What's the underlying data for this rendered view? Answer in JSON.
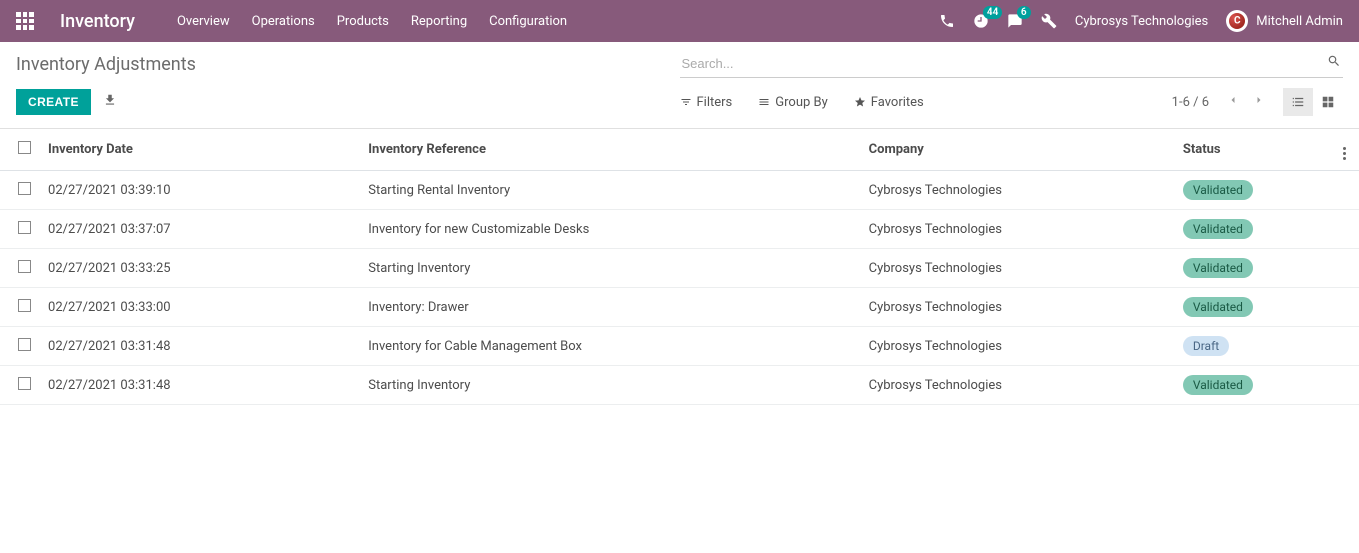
{
  "navbar": {
    "brand": "Inventory",
    "menu": [
      "Overview",
      "Operations",
      "Products",
      "Reporting",
      "Configuration"
    ],
    "activities_badge": "44",
    "messages_badge": "6",
    "company": "Cybrosys Technologies",
    "user": "Mitchell Admin"
  },
  "breadcrumb": "Inventory Adjustments",
  "search": {
    "placeholder": "Search..."
  },
  "buttons": {
    "create": "CREATE"
  },
  "filters": {
    "filters": "Filters",
    "groupby": "Group By",
    "favorites": "Favorites"
  },
  "pager": "1-6 / 6",
  "columns": {
    "date": "Inventory Date",
    "ref": "Inventory Reference",
    "company": "Company",
    "status": "Status"
  },
  "rows": [
    {
      "date": "02/27/2021 03:39:10",
      "ref": "Starting Rental Inventory",
      "company": "Cybrosys Technologies",
      "status": "Validated",
      "status_class": "validated"
    },
    {
      "date": "02/27/2021 03:37:07",
      "ref": "Inventory for new Customizable Desks",
      "company": "Cybrosys Technologies",
      "status": "Validated",
      "status_class": "validated"
    },
    {
      "date": "02/27/2021 03:33:25",
      "ref": "Starting Inventory",
      "company": "Cybrosys Technologies",
      "status": "Validated",
      "status_class": "validated"
    },
    {
      "date": "02/27/2021 03:33:00",
      "ref": "Inventory: Drawer",
      "company": "Cybrosys Technologies",
      "status": "Validated",
      "status_class": "validated"
    },
    {
      "date": "02/27/2021 03:31:48",
      "ref": "Inventory for Cable Management Box",
      "company": "Cybrosys Technologies",
      "status": "Draft",
      "status_class": "draft"
    },
    {
      "date": "02/27/2021 03:31:48",
      "ref": "Starting Inventory",
      "company": "Cybrosys Technologies",
      "status": "Validated",
      "status_class": "validated"
    }
  ]
}
